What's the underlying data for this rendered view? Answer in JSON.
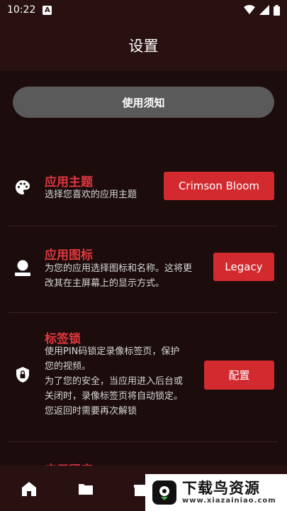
{
  "status_bar": {
    "time": "10:22",
    "badge": "A"
  },
  "header": {
    "title": "设置"
  },
  "notice_button": {
    "label": "使用须知"
  },
  "rows": [
    {
      "title": "应用主题",
      "desc": [
        "选择您喜欢的应用主题"
      ],
      "button": "Crimson Bloom",
      "icon": "palette-icon"
    },
    {
      "title": "应用图标",
      "desc": [
        "为您的应用选择图标和名称。这将更",
        "改其在主屏幕上的显示方式。"
      ],
      "button": "Legacy",
      "icon": "person-icon"
    },
    {
      "title": "标签锁",
      "desc": [
        "使用PIN码锁定录像标签页，保护",
        "您的视频。",
        "为了您的安全，当应用进入后台或",
        "关闭时，录像标签页将自动锁定。",
        "您返回时需要再次解锁"
      ],
      "button": "配置",
      "icon": "lock-shield-icon"
    },
    {
      "title": "应用程序",
      "desc": [],
      "button": "",
      "icon": ""
    }
  ],
  "bottom_nav": [
    {
      "icon": "home-icon"
    },
    {
      "icon": "folder-icon"
    },
    {
      "icon": "gift-icon"
    }
  ],
  "watermark": {
    "main": "下载鸟资源",
    "url": "www.xiazainiao.com"
  },
  "colors": {
    "accent": "#d22a2f",
    "title_red": "#e0373e",
    "background": "#1c0c0c",
    "bar": "#2a1111"
  }
}
